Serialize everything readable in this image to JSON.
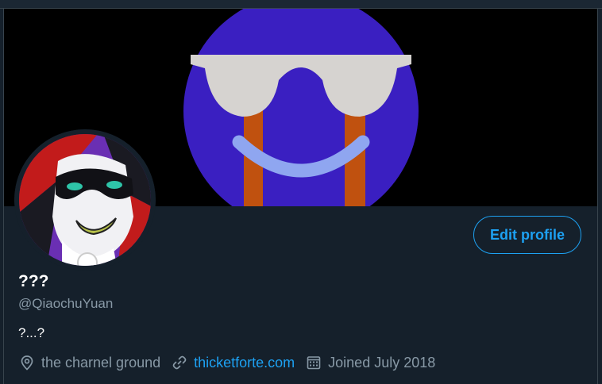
{
  "profile": {
    "display_name": "???",
    "handle": "@QiaochuYuan",
    "bio": "?...?",
    "location": "the charnel ground",
    "website": "thicketforte.com",
    "joined": "Joined July 2018"
  },
  "actions": {
    "edit_profile_label": "Edit profile"
  },
  "icons": {
    "location": "location-pin-icon",
    "website": "link-icon",
    "joined": "calendar-icon"
  },
  "colors": {
    "background": "#15202b",
    "accent": "#1da1f2",
    "secondary_text": "#8899a6",
    "primary_text": "#ffffff",
    "banner_background": "#000000",
    "banner_circle": "#3a1fc1",
    "banner_glasses": "#d6d3d0",
    "banner_smile": "#8fa6f0",
    "banner_legs": "#c0510f"
  }
}
